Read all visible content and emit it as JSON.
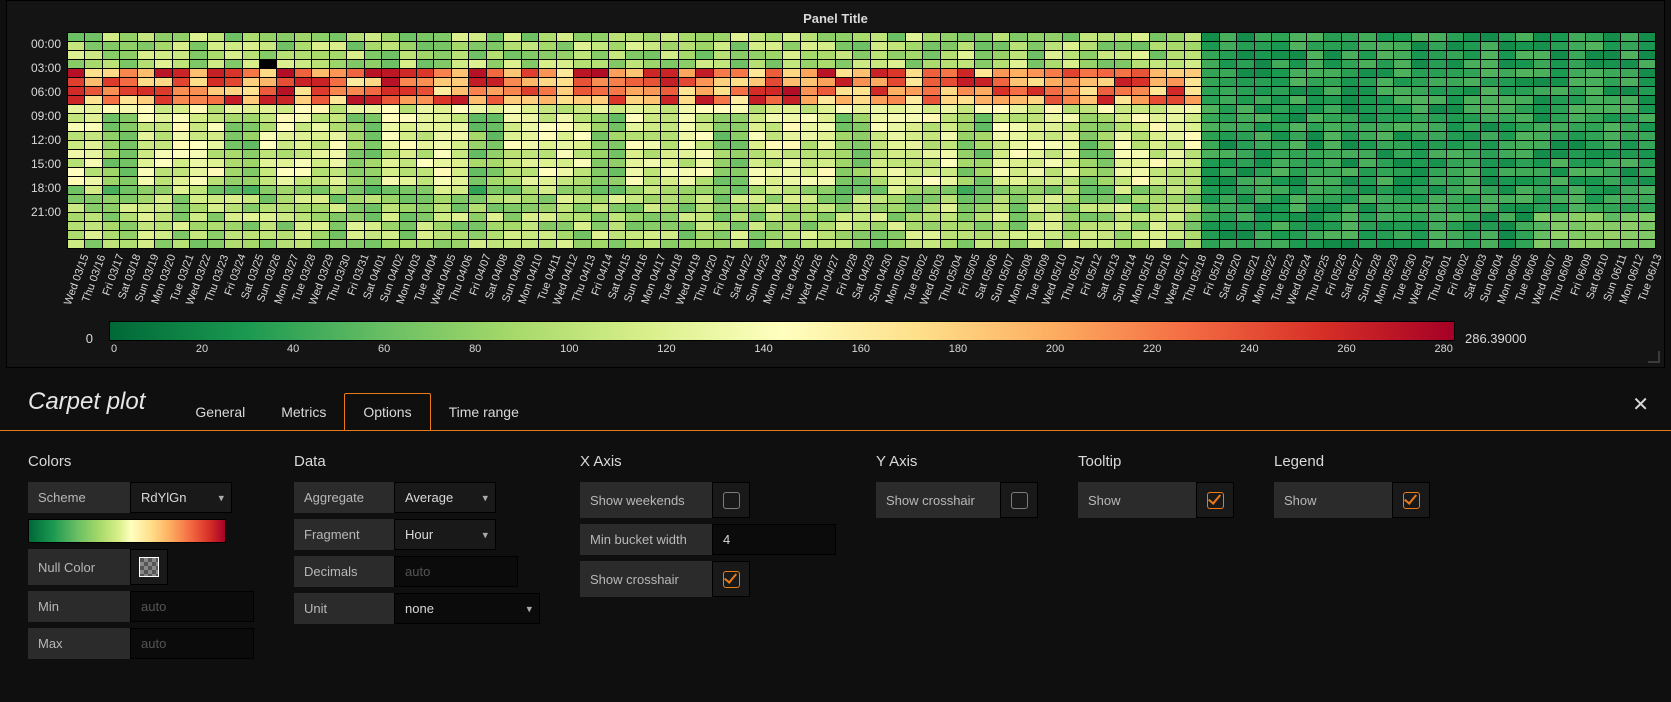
{
  "panel": {
    "title": "Panel Title"
  },
  "chart_data": {
    "type": "heatmap",
    "title": "Panel Title",
    "y_labels": [
      "00:00",
      "03:00",
      "06:00",
      "09:00",
      "12:00",
      "15:00",
      "18:00",
      "21:00"
    ],
    "x_labels": [
      "Wed 03/15",
      "Thu 03/16",
      "Fri 03/17",
      "Sat 03/18",
      "Sun 03/19",
      "Mon 03/20",
      "Tue 03/21",
      "Wed 03/22",
      "Thu 03/23",
      "Fri 03/24",
      "Sat 03/25",
      "Sun 03/26",
      "Mon 03/27",
      "Tue 03/28",
      "Wed 03/29",
      "Thu 03/30",
      "Fri 03/31",
      "Sat 04/01",
      "Sun 04/02",
      "Mon 04/03",
      "Tue 04/04",
      "Wed 04/05",
      "Thu 04/06",
      "Fri 04/07",
      "Sat 04/08",
      "Sun 04/09",
      "Mon 04/10",
      "Tue 04/11",
      "Wed 04/12",
      "Thu 04/13",
      "Fri 04/14",
      "Sat 04/15",
      "Sun 04/16",
      "Mon 04/17",
      "Tue 04/18",
      "Wed 04/19",
      "Thu 04/20",
      "Fri 04/21",
      "Sat 04/22",
      "Sun 04/23",
      "Mon 04/24",
      "Tue 04/25",
      "Wed 04/26",
      "Thu 04/27",
      "Fri 04/28",
      "Sat 04/29",
      "Sun 04/30",
      "Mon 05/01",
      "Tue 05/02",
      "Wed 05/03",
      "Thu 05/04",
      "Fri 05/05",
      "Sat 05/06",
      "Sun 05/07",
      "Mon 05/08",
      "Tue 05/09",
      "Wed 05/10",
      "Thu 05/11",
      "Fri 05/12",
      "Sat 05/13",
      "Sun 05/14",
      "Mon 05/15",
      "Tue 05/16",
      "Wed 05/17",
      "Thu 05/18",
      "Fri 05/19",
      "Sat 05/20",
      "Sun 05/21",
      "Mon 05/22",
      "Tue 05/23",
      "Wed 05/24",
      "Thu 05/25",
      "Fri 05/26",
      "Sat 05/27",
      "Sun 05/28",
      "Mon 05/29",
      "Tue 05/30",
      "Wed 05/31",
      "Thu 06/01",
      "Fri 06/02",
      "Sat 06/03",
      "Sun 06/04",
      "Mon 06/05",
      "Tue 06/06",
      "Wed 06/07",
      "Thu 06/08",
      "Fri 06/09",
      "Sat 06/10",
      "Sun 06/11",
      "Mon 06/12",
      "Tue 06/13"
    ],
    "color_scale": "RdYlGn",
    "range": [
      0,
      286.39
    ],
    "ticks": [
      "0",
      "20",
      "40",
      "60",
      "80",
      "100",
      "120",
      "140",
      "160",
      "180",
      "200",
      "220",
      "240",
      "260",
      "280"
    ],
    "note": "Hourly values per day; early-morning hours 05:00–07:00 on many March/April weekdays spike toward 200–280 (red). Midday/afternoon mostly 80–150 (yellow-green). From roughly Fri 05/19 onward values drop sharply to 10–50 (deep green). Late-evening June days climb slightly toward 60–90."
  },
  "legend": {
    "min": "0",
    "max": "286.39000"
  },
  "editor": {
    "title": "Carpet plot",
    "tabs": {
      "general": "General",
      "metrics": "Metrics",
      "options": "Options",
      "timerange": "Time range"
    },
    "colors": {
      "header": "Colors",
      "scheme_label": "Scheme",
      "scheme_value": "RdYlGn",
      "nullcolor_label": "Null Color",
      "min_label": "Min",
      "min_placeholder": "auto",
      "max_label": "Max",
      "max_placeholder": "auto"
    },
    "data": {
      "header": "Data",
      "aggregate_label": "Aggregate",
      "aggregate_value": "Average",
      "fragment_label": "Fragment",
      "fragment_value": "Hour",
      "decimals_label": "Decimals",
      "decimals_placeholder": "auto",
      "unit_label": "Unit",
      "unit_value": "none"
    },
    "xaxis": {
      "header": "X Axis",
      "weekends_label": "Show weekends",
      "weekends_checked": false,
      "minbucket_label": "Min bucket width",
      "minbucket_value": "4",
      "crosshair_label": "Show crosshair",
      "crosshair_checked": true
    },
    "yaxis": {
      "header": "Y Axis",
      "crosshair_label": "Show crosshair",
      "crosshair_checked": false
    },
    "tooltip": {
      "header": "Tooltip",
      "show_label": "Show",
      "show_checked": true
    },
    "legendsec": {
      "header": "Legend",
      "show_label": "Show",
      "show_checked": true
    }
  }
}
